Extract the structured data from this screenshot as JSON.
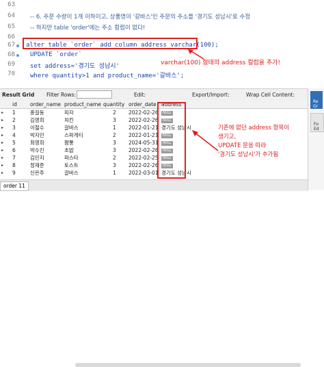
{
  "editor": {
    "lines": [
      {
        "num": "63",
        "code": ""
      },
      {
        "num": "64",
        "code": "-- 6. 주문 수량이 1개 이하이고, 상품명이 '갈바스'인 주문의 주소를 '경기도 성남시'로 수정"
      },
      {
        "num": "65",
        "code": "-- 하지만 table 'order'에는 주소 컬럼이 없다!"
      },
      {
        "num": "66",
        "code": ""
      },
      {
        "num": "67",
        "code": "alter table `order` add column address varchar(100);"
      },
      {
        "num": "68",
        "code": "UPDATE `order`"
      },
      {
        "num": "69",
        "code": "set address='경기도 성남시'"
      },
      {
        "num": "70",
        "code": "where quantity>1 and product_name='갈바스';"
      }
    ],
    "annotation": "varchar(100) 형태의 address 컬럼을 추가!"
  },
  "toolbar": {
    "result_grid": "Result Grid",
    "filter_rows": "Filter Rows:",
    "edit": "Edit:",
    "export": "Export/Import:",
    "wrap": "Wrap Cell Content:"
  },
  "grid": {
    "columns": [
      "id",
      "order_name",
      "product_name",
      "quantity",
      "order_date",
      "address"
    ],
    "rows": [
      [
        "1",
        "홍길동",
        "피자",
        "2",
        "2022-02-26",
        null
      ],
      [
        "2",
        "김영희",
        "치킨",
        "3",
        "2022-02-26",
        null
      ],
      [
        "3",
        "이철수",
        "갈바스",
        "1",
        "2022-01-21",
        "경기도 성남시"
      ],
      [
        "4",
        "박지민",
        "스파게티",
        "2",
        "2022-01-21",
        null
      ],
      [
        "5",
        "최영희",
        "짬뽕",
        "3",
        "2024-05-31",
        null
      ],
      [
        "6",
        "박수진",
        "초밥",
        "3",
        "2022-02-26",
        null
      ],
      [
        "7",
        "김민지",
        "파스타",
        "2",
        "2022-02-25",
        null
      ],
      [
        "8",
        "정재준",
        "토스트",
        "3",
        "2022-02-26",
        null
      ],
      [
        "9",
        "신은주",
        "갈바스",
        "1",
        "2022-03-01",
        "경기도 성남시"
      ]
    ],
    "null_label": "NULL"
  },
  "annotation2": [
    "기존에 없던 address 항목이",
    "생기고,",
    "UPDATE 문을 따라",
    "'경기도 성남시'가 추가됨"
  ],
  "right_panel": {
    "result_label": "Re Gr",
    "form_label": "Fo Ed"
  },
  "bottom": {
    "tab_label": "order 11"
  }
}
